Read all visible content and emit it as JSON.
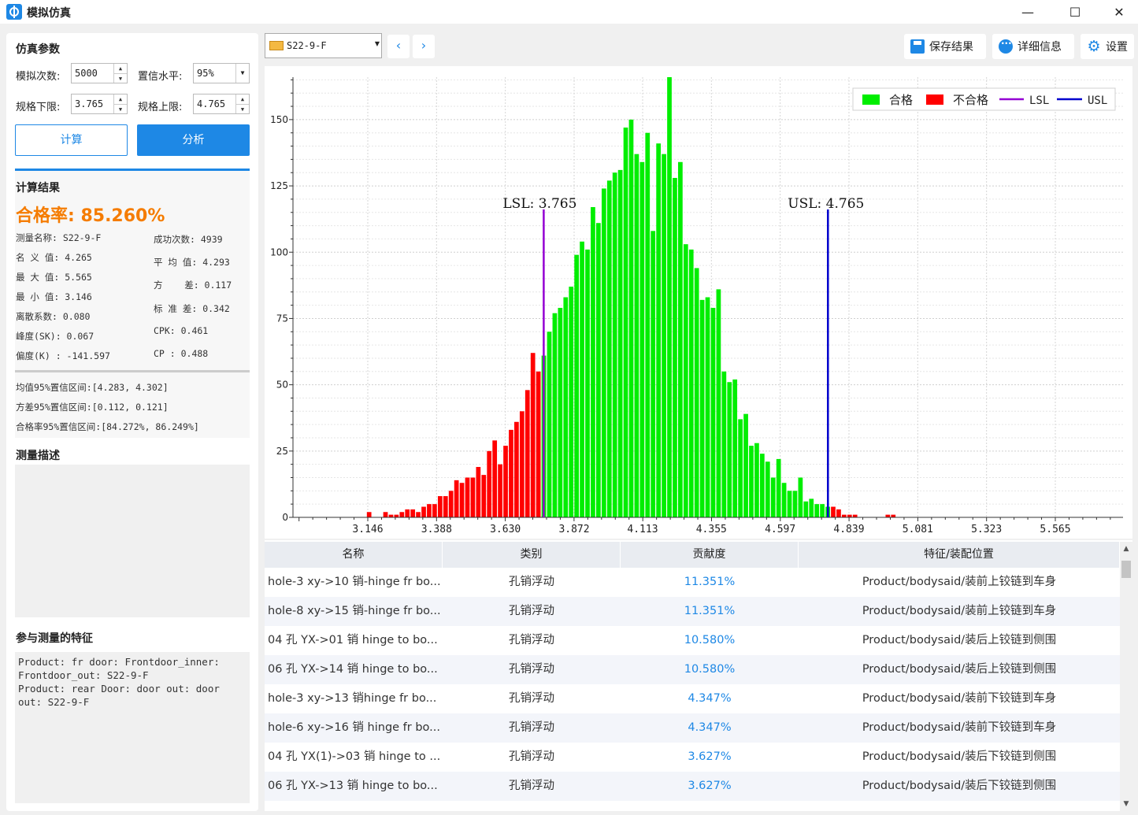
{
  "window": {
    "title": "模拟仿真",
    "minimize": "—",
    "maximize": "☐",
    "close": "✕"
  },
  "params": {
    "section_title": "仿真参数",
    "sim_count_label": "模拟次数:",
    "sim_count_value": "5000",
    "confidence_label": "置信水平:",
    "confidence_value": "95%",
    "lsl_label": "规格下限:",
    "lsl_value": "3.765",
    "usl_label": "规格上限:",
    "usl_value": "4.765",
    "calc_button": "计算",
    "analyze_button": "分析"
  },
  "results": {
    "section_title": "计算结果",
    "pass_rate": "合格率: 85.260%",
    "left_stats": [
      "测量名称: S22-9-F",
      "名 义 值: 4.265",
      "最 大 值: 5.565",
      "最 小 值: 3.146",
      "离散系数: 0.080",
      "峰度(SK): 0.067",
      "偏度(K) : -141.597"
    ],
    "right_stats": [
      "成功次数: 4939",
      "平 均 值: 4.293",
      "方    差: 0.117",
      "标 准 差: 0.342",
      "CPK: 0.461",
      "CP : 0.488"
    ],
    "ci": [
      "均值95%置信区间:[4.283, 4.302]",
      "方差95%置信区间:[0.112, 0.121]",
      "合格率95%置信区间:[84.272%, 86.249%]"
    ]
  },
  "description": {
    "section_title": "测量描述",
    "text": ""
  },
  "features": {
    "section_title": "参与测量的特征",
    "text": "Product: fr door: Frontdoor_inner:\nFrontdoor_out: S22-9-F\nProduct: rear Door: door out: door\nout: S22-9-F"
  },
  "toolbar": {
    "measurement_select": "S22-9-F",
    "prev": "‹",
    "next": "›",
    "save_label": "保存结果",
    "detail_label": "详细信息",
    "settings_label": "设置",
    "gear_glyph": "⚙"
  },
  "chart_data": {
    "type": "bar",
    "title": "",
    "xlabel": "",
    "ylabel": "",
    "x_ticks": [
      "3.146",
      "3.388",
      "3.630",
      "3.872",
      "4.113",
      "4.355",
      "4.597",
      "4.839",
      "5.081",
      "5.323",
      "5.565"
    ],
    "y_ticks": [
      0,
      25,
      50,
      75,
      100,
      125,
      150
    ],
    "xlim": [
      3.146,
      5.565
    ],
    "ylim": [
      0,
      166
    ],
    "bin_width": 0.01921,
    "bin_start": 3.0546,
    "legend": [
      "合格",
      "不合格",
      "LSL",
      "USL"
    ],
    "legend_position": "top-right",
    "colors": {
      "pass": "#00ee00",
      "fail": "#ff0000",
      "lsl": "#9400d3",
      "usl": "#0000cd"
    },
    "lsl": {
      "value": 3.765,
      "label": "LSL: 3.765"
    },
    "usl": {
      "value": 4.765,
      "label": "USL: 4.765"
    },
    "bins": [
      {
        "x": 3.1507,
        "count": 2
      },
      {
        "x": 3.2084,
        "count": 2
      },
      {
        "x": 3.2276,
        "count": 1
      },
      {
        "x": 3.2468,
        "count": 1
      },
      {
        "x": 3.266,
        "count": 2
      },
      {
        "x": 3.2852,
        "count": 3
      },
      {
        "x": 3.3044,
        "count": 3
      },
      {
        "x": 3.3236,
        "count": 2
      },
      {
        "x": 3.3428,
        "count": 4
      },
      {
        "x": 3.362,
        "count": 5
      },
      {
        "x": 3.3812,
        "count": 5
      },
      {
        "x": 3.4005,
        "count": 8
      },
      {
        "x": 3.4197,
        "count": 8
      },
      {
        "x": 3.4389,
        "count": 10
      },
      {
        "x": 3.4581,
        "count": 14
      },
      {
        "x": 3.4773,
        "count": 13
      },
      {
        "x": 3.4965,
        "count": 15
      },
      {
        "x": 3.5157,
        "count": 15
      },
      {
        "x": 3.5349,
        "count": 19
      },
      {
        "x": 3.5541,
        "count": 16
      },
      {
        "x": 3.5733,
        "count": 25
      },
      {
        "x": 3.5926,
        "count": 29
      },
      {
        "x": 3.6118,
        "count": 20
      },
      {
        "x": 3.631,
        "count": 27
      },
      {
        "x": 3.6502,
        "count": 33
      },
      {
        "x": 3.6694,
        "count": 36
      },
      {
        "x": 3.6886,
        "count": 40
      },
      {
        "x": 3.7078,
        "count": 48
      },
      {
        "x": 3.727,
        "count": 62
      },
      {
        "x": 3.7462,
        "count": 55
      },
      {
        "x": 3.7654,
        "count": 61
      },
      {
        "x": 3.7847,
        "count": 70
      },
      {
        "x": 3.8039,
        "count": 77
      },
      {
        "x": 3.8231,
        "count": 79
      },
      {
        "x": 3.8423,
        "count": 83
      },
      {
        "x": 3.8615,
        "count": 87
      },
      {
        "x": 3.8807,
        "count": 99
      },
      {
        "x": 3.8999,
        "count": 104
      },
      {
        "x": 3.9191,
        "count": 101
      },
      {
        "x": 3.9383,
        "count": 117
      },
      {
        "x": 3.9575,
        "count": 111
      },
      {
        "x": 3.9768,
        "count": 124
      },
      {
        "x": 3.996,
        "count": 127
      },
      {
        "x": 4.0152,
        "count": 130
      },
      {
        "x": 4.0344,
        "count": 131
      },
      {
        "x": 4.0536,
        "count": 147
      },
      {
        "x": 4.0728,
        "count": 150
      },
      {
        "x": 4.092,
        "count": 137
      },
      {
        "x": 4.1112,
        "count": 134
      },
      {
        "x": 4.1304,
        "count": 145
      },
      {
        "x": 4.1496,
        "count": 108
      },
      {
        "x": 4.1689,
        "count": 141
      },
      {
        "x": 4.1881,
        "count": 137
      },
      {
        "x": 4.2073,
        "count": 166
      },
      {
        "x": 4.2265,
        "count": 128
      },
      {
        "x": 4.2457,
        "count": 134
      },
      {
        "x": 4.2649,
        "count": 103
      },
      {
        "x": 4.2841,
        "count": 101
      },
      {
        "x": 4.3033,
        "count": 94
      },
      {
        "x": 4.3225,
        "count": 82
      },
      {
        "x": 4.3417,
        "count": 83
      },
      {
        "x": 4.3609,
        "count": 79
      },
      {
        "x": 4.3802,
        "count": 86
      },
      {
        "x": 4.3994,
        "count": 55
      },
      {
        "x": 4.4186,
        "count": 51
      },
      {
        "x": 4.4378,
        "count": 52
      },
      {
        "x": 4.457,
        "count": 37
      },
      {
        "x": 4.4762,
        "count": 39
      },
      {
        "x": 4.4954,
        "count": 27
      },
      {
        "x": 4.5146,
        "count": 28
      },
      {
        "x": 4.5338,
        "count": 24
      },
      {
        "x": 4.553,
        "count": 21
      },
      {
        "x": 4.5723,
        "count": 15
      },
      {
        "x": 4.5915,
        "count": 22
      },
      {
        "x": 4.6107,
        "count": 13
      },
      {
        "x": 4.6299,
        "count": 10
      },
      {
        "x": 4.6491,
        "count": 10
      },
      {
        "x": 4.6683,
        "count": 15
      },
      {
        "x": 4.6875,
        "count": 6
      },
      {
        "x": 4.7067,
        "count": 7
      },
      {
        "x": 4.7259,
        "count": 5
      },
      {
        "x": 4.7451,
        "count": 5
      },
      {
        "x": 4.7644,
        "count": 4
      },
      {
        "x": 4.7836,
        "count": 4
      },
      {
        "x": 4.8028,
        "count": 3
      },
      {
        "x": 4.822,
        "count": 1
      },
      {
        "x": 4.8412,
        "count": 1
      },
      {
        "x": 4.8604,
        "count": 1
      },
      {
        "x": 4.9757,
        "count": 1
      },
      {
        "x": 4.9949,
        "count": 1
      }
    ]
  },
  "table": {
    "headers": [
      "名称",
      "类别",
      "贡献度",
      "特征/装配位置"
    ],
    "rows": [
      {
        "name": "hole-3 xy->10 销-hinge fr bo...",
        "category": "孔销浮动",
        "contribution": "11.351%",
        "location": "Product/bodysaid/装前上铰链到车身"
      },
      {
        "name": "hole-8 xy->15 销-hinge fr bo...",
        "category": "孔销浮动",
        "contribution": "11.351%",
        "location": "Product/bodysaid/装前上铰链到车身"
      },
      {
        "name": "04 孔 YX->01 销 hinge to bo...",
        "category": "孔销浮动",
        "contribution": "10.580%",
        "location": "Product/bodysaid/装后上铰链到侧围"
      },
      {
        "name": "06 孔 YX->14 销 hinge to bo...",
        "category": "孔销浮动",
        "contribution": "10.580%",
        "location": "Product/bodysaid/装后上铰链到侧围"
      },
      {
        "name": " hole-3 xy->13 销hinge fr bo...",
        "category": "孔销浮动",
        "contribution": "4.347%",
        "location": "Product/bodysaid/装前下铰链到车身"
      },
      {
        "name": "hole-6 xy->16 销 hinge fr bo...",
        "category": "孔销浮动",
        "contribution": "4.347%",
        "location": "Product/bodysaid/装前下铰链到车身"
      },
      {
        "name": " 04 孔 YX(1)->03 销 hinge to ...",
        "category": "孔销浮动",
        "contribution": "3.627%",
        "location": "Product/bodysaid/装后下铰链到侧围"
      },
      {
        "name": "06 孔 YX->13 销 hinge to bo...",
        "category": "孔销浮动",
        "contribution": "3.627%",
        "location": "Product/bodysaid/装后下铰链到侧围"
      }
    ]
  }
}
